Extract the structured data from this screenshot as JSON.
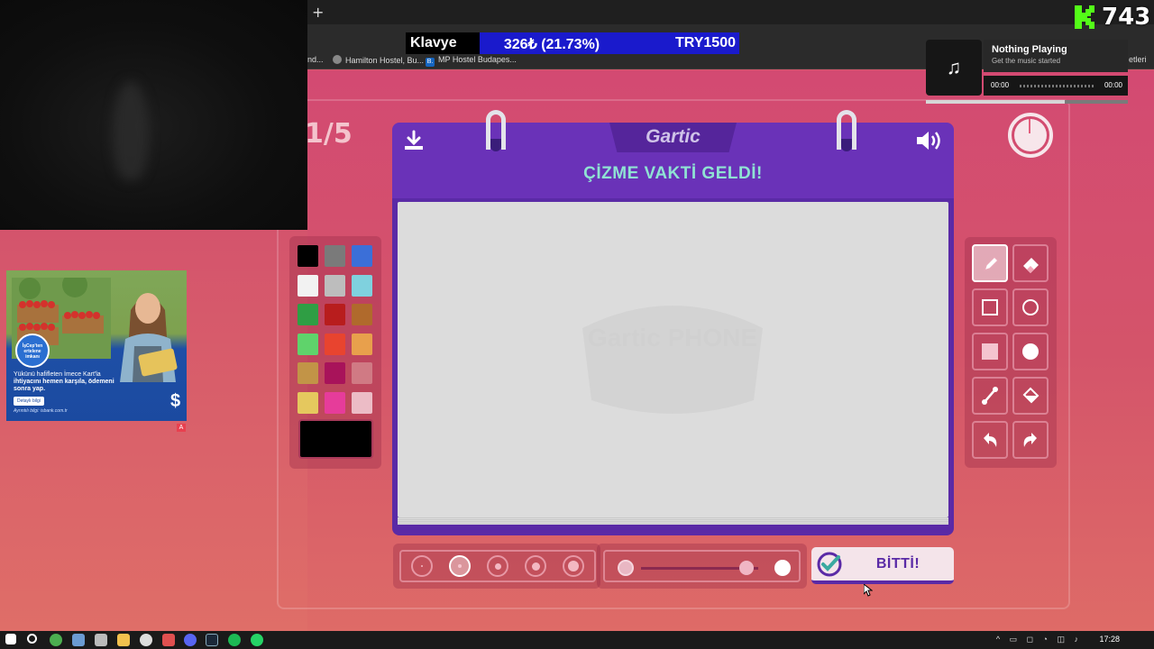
{
  "browser": {
    "new_tab_symbol": "+",
    "bookmarks": [
      {
        "label": "nd...",
        "icon": "folder-icon"
      },
      {
        "label": "Hamilton Hostel, Bu...",
        "icon": "globe-icon"
      },
      {
        "label": "MP Hostel Budapes...",
        "icon": "booking-icon",
        "badge": "B."
      },
      {
        "label": "etleri",
        "icon": "folder-icon"
      }
    ]
  },
  "ticker": {
    "name": "Klavye",
    "change": "326₺ (21.73%)",
    "price": "TRY1500"
  },
  "score_overlay": {
    "value": "743",
    "brand_color": "#53fc18"
  },
  "music": {
    "title": "Nothing Playing",
    "subtitle": "Get the music started",
    "time_elapsed": "00:00",
    "time_total": "00:00"
  },
  "ad": {
    "badge": "İşCep'ten ertelene imkanı",
    "headline": "Yükünü hafifleten İmece Kart'la",
    "bold_line": "ihtiyacını hemen karşıla, ödemeni sonra yap.",
    "button": "Detaylı bilgi",
    "footer": "Ayrıntılı bilgi: isbank.com.tr",
    "adchoice": "A"
  },
  "game": {
    "round": "1/5",
    "logo": "Gartic",
    "headline": "ÇİZME VAKTİ GELDİ!",
    "done_label": "BİTTİ!",
    "watermark": "Gartic PHONE",
    "current_color": "#000000",
    "palette": [
      "#000000",
      "#7a7a7a",
      "#3b6fd8",
      "#f2f2f2",
      "#bdbdbd",
      "#7fd1de",
      "#2f9e44",
      "#b81d1d",
      "#b06a2c",
      "#5fd36b",
      "#e8442f",
      "#e8a04c",
      "#c29447",
      "#a8135a",
      "#d07a84",
      "#e5c85e",
      "#e63c9a",
      "#ecbcc6"
    ],
    "tools": [
      {
        "name": "pencil-icon",
        "active": true
      },
      {
        "name": "eraser-icon",
        "active": false
      },
      {
        "name": "rectangle-outline-icon",
        "active": false
      },
      {
        "name": "ellipse-outline-icon",
        "active": false
      },
      {
        "name": "rectangle-filled-icon",
        "active": false
      },
      {
        "name": "ellipse-filled-icon",
        "active": false
      },
      {
        "name": "line-icon",
        "active": false
      },
      {
        "name": "fill-bucket-icon",
        "active": false
      },
      {
        "name": "undo-icon",
        "active": false
      },
      {
        "name": "redo-icon",
        "active": false
      }
    ],
    "brush_sizes": 5,
    "selected_brush_size": 2,
    "opacity_level": 0.9
  },
  "taskbar": {
    "clock": "17:28"
  }
}
